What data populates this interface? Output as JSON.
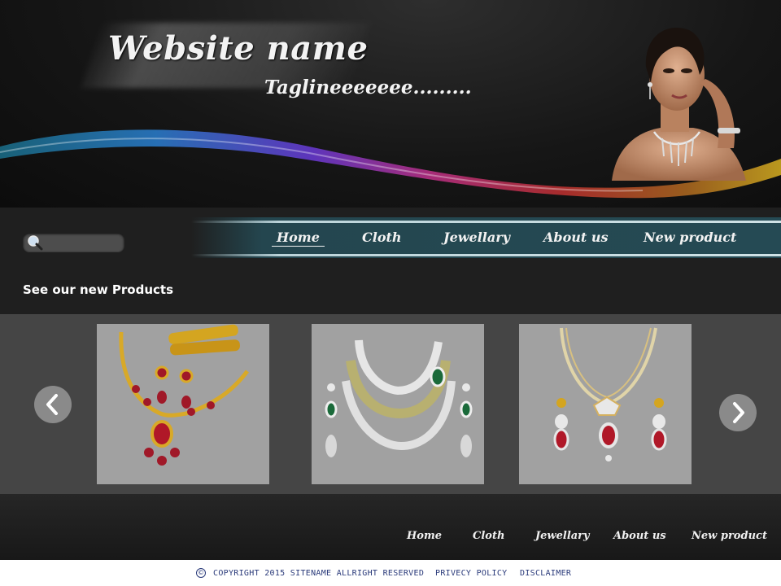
{
  "header": {
    "site_name": "Website name",
    "tagline": "Taglineeeeeee........."
  },
  "nav": {
    "items": [
      {
        "label": "Home",
        "active": true
      },
      {
        "label": "Cloth"
      },
      {
        "label": "Jewellary"
      },
      {
        "label": "About us"
      },
      {
        "label": "New product"
      }
    ]
  },
  "search": {
    "placeholder": "",
    "icon": "search-icon"
  },
  "products": {
    "title": "See our new Products",
    "items": [
      {
        "name": "gold-ruby-necklace-set"
      },
      {
        "name": "diamond-emerald-choker-set"
      },
      {
        "name": "diamond-ruby-necklace-set"
      }
    ],
    "prev_icon": "chevron-left-icon",
    "next_icon": "chevron-right-icon"
  },
  "footer": {
    "links": [
      "Home",
      "Cloth",
      "Jewellary",
      "About us",
      "New product"
    ],
    "copyright": "COPYRIGHT 2015 SITENAME ALLRIGHT RESERVED",
    "privacy": "PRIVECY POLICY",
    "disclaimer": "DISCLAIMER",
    "copyright_icon": "©"
  },
  "colors": {
    "nav_bar": "#254a54",
    "carousel_bg": "#454545",
    "card_bg": "#a1a1a1",
    "footer_text": "#2a3a7a"
  }
}
